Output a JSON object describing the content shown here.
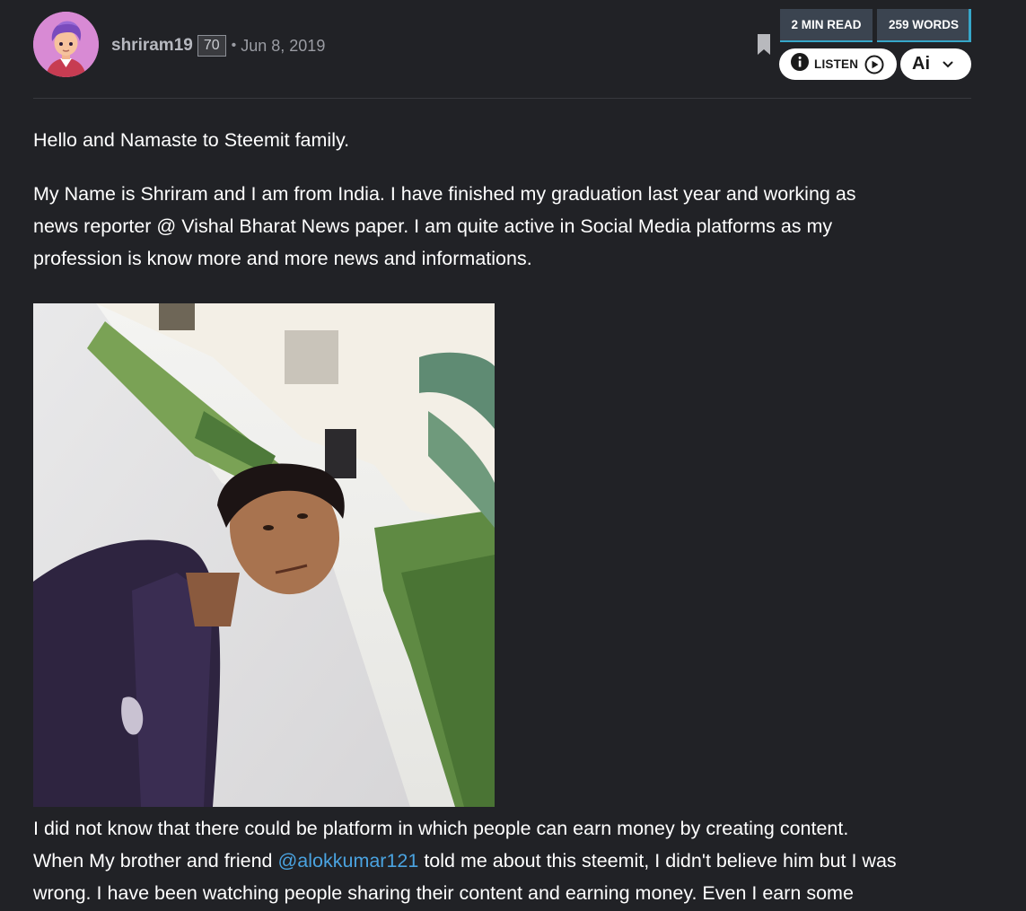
{
  "author": {
    "name": "shriram19",
    "reputation": "70",
    "separator": "•",
    "date": "Jun 8, 2019"
  },
  "stats": {
    "read_time": "2 MIN READ",
    "word_count": "259 WORDS"
  },
  "actions": {
    "listen_label": "LISTEN",
    "ai_label": "Ai"
  },
  "icons": {
    "bookmark": "bookmark-icon",
    "info": "info-icon",
    "play": "play-circle-icon",
    "chevron": "chevron-down-icon"
  },
  "colors": {
    "background": "#212226",
    "stat_background": "#3b4450",
    "stat_accent": "#36a7c9",
    "mention": "#4aa3e0",
    "avatar_bg": "#d88ad4"
  },
  "post": {
    "p1": "Hello and Namaste to Steemit family.",
    "p2_lines": [
      "My Name is Shriram and I am from India. I have finished my graduation last year and working as",
      "news reporter @ Vishal Bharat News paper. I am quite active in Social Media platforms as my",
      "profession is know more and more news and informations."
    ],
    "p3_line1": "I did not know that there could be platform in which people can earn money by creating content.",
    "p3_line2_before": "When My brother and friend ",
    "p3_mention": "@alokkumar121",
    "p3_line2_after": " told me about this steemit, I didn't believe him but I was",
    "p3_line3": "wrong. I have been watching people sharing their content and earning money. Even I earn some"
  }
}
